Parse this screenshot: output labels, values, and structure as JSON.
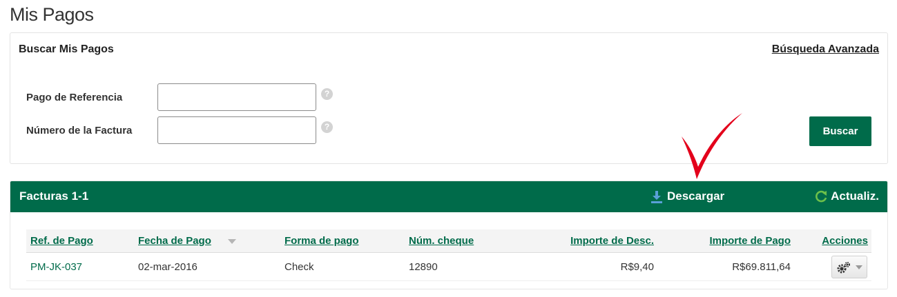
{
  "page": {
    "title": "Mis Pagos"
  },
  "search": {
    "title": "Buscar Mis Pagos",
    "advanced_link": "Búsqueda Avanzada",
    "fields": [
      {
        "label": "Pago de Referencia",
        "value": "",
        "help": "?"
      },
      {
        "label": "Número de la Factura",
        "value": "",
        "help": "?"
      }
    ],
    "button_label": "Buscar"
  },
  "results": {
    "title": "Facturas 1-1",
    "download_label": "Descargar",
    "refresh_label": "Actualiz.",
    "columns": [
      "Ref. de Pago",
      "Fecha de Pago",
      "Forma de pago",
      "Núm. cheque",
      "Importe de Desc.",
      "Importe de Pago",
      "Acciones"
    ],
    "sorted_column": "Fecha de Pago",
    "rows": [
      {
        "ref": "PM-JK-037",
        "date": "02-mar-2016",
        "method": "Check",
        "check_number": "12890",
        "discount": "R$9,40",
        "amount": "R$69.811,64",
        "actions_icon": "gear-icon"
      }
    ]
  },
  "colors": {
    "brand_green": "#006b4a",
    "annotation_red": "#e3001b",
    "download_blue": "#5aa0d8",
    "refresh_green": "#6cc04a"
  }
}
